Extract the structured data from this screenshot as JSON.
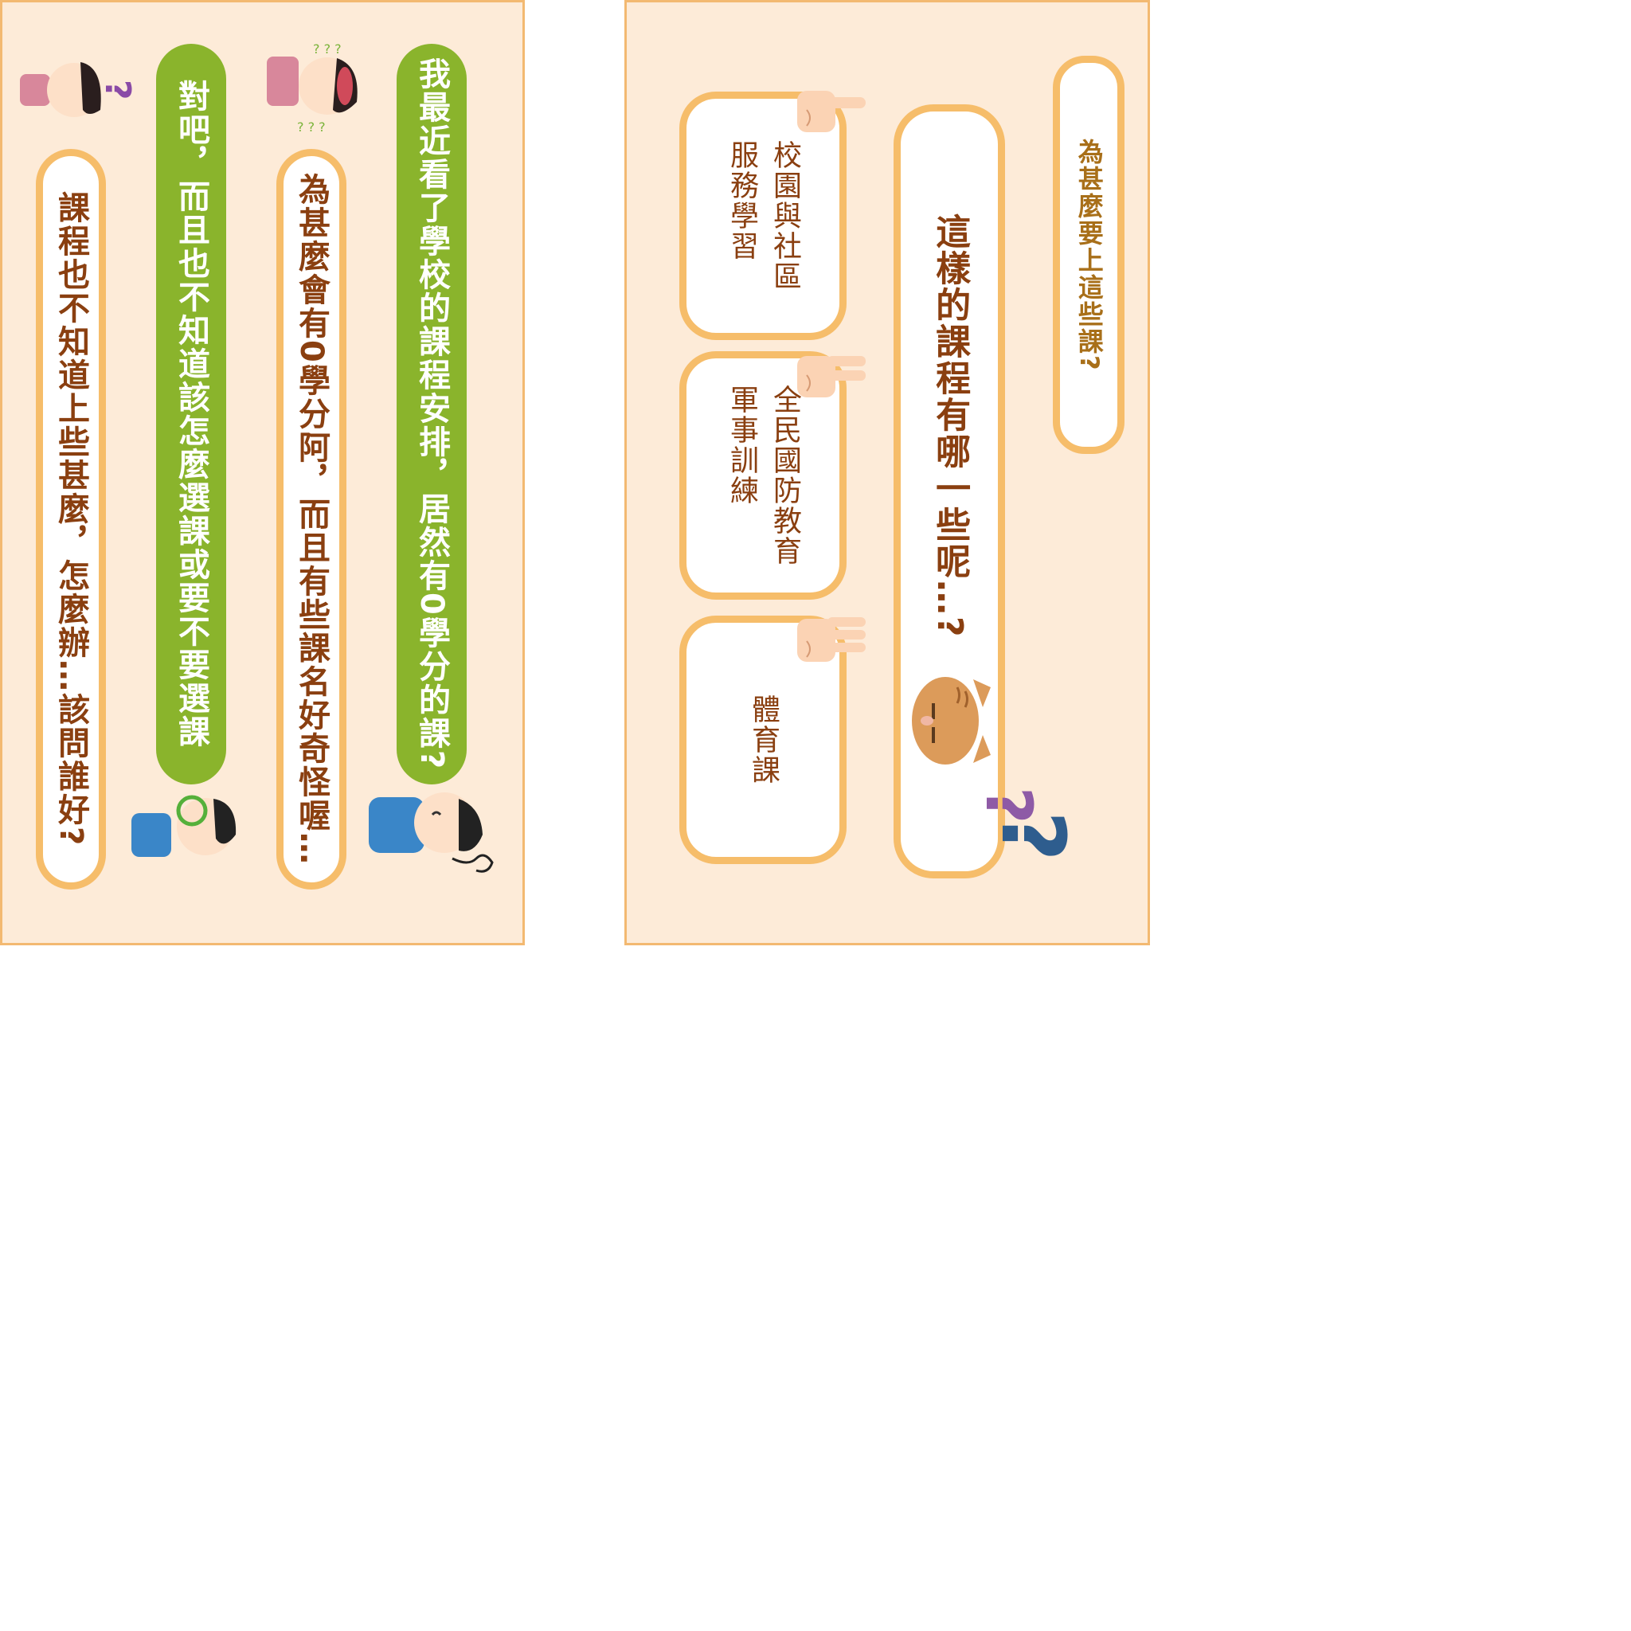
{
  "left_panel": {
    "bubbles": [
      {
        "text": "我最近看了學校的課程安排，居然有0學分的課?",
        "style": "green"
      },
      {
        "text": "為甚麼會有0學分阿，而且有些課名好奇怪喔…",
        "style": "white"
      },
      {
        "text": "對吧，而且也不知道該怎麼選課或要不要選課",
        "style": "green"
      },
      {
        "text": "課程也不知道上些甚麼，怎麼辦…該問誰好?",
        "style": "white"
      }
    ]
  },
  "right_panel": {
    "title": "為甚麼要上這些課?",
    "question": "這樣的課程有哪一些呢…?",
    "courses": [
      {
        "line1": "校園與社區",
        "line2": "服務學習"
      },
      {
        "line1": "全民國防教育",
        "line2": "軍事訓練"
      },
      {
        "line1": "體育課",
        "line2": ""
      }
    ]
  },
  "colors": {
    "panel_bg": "#fdebd8",
    "panel_border": "#f3b971",
    "green": "#8ab42c",
    "brown_text": "#8a3f10"
  }
}
